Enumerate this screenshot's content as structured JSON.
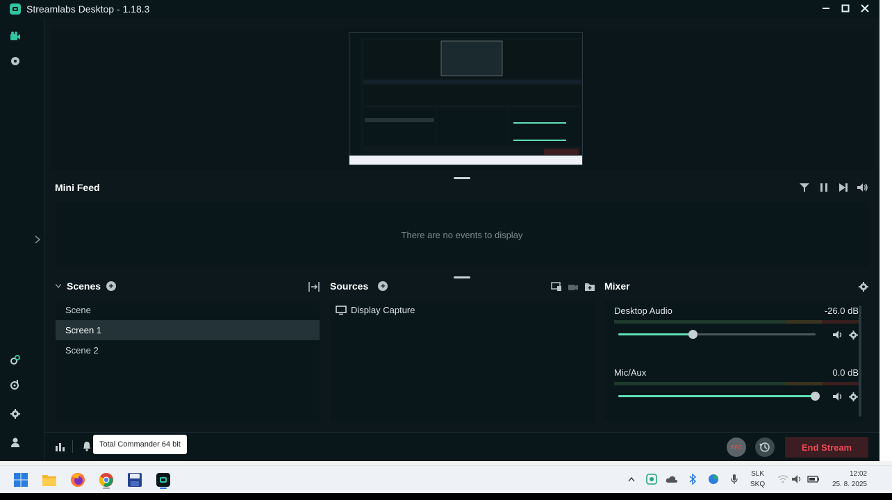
{
  "window": {
    "title": "Streamlabs Desktop - 1.18.3",
    "controls": [
      "minimize",
      "maximize",
      "close"
    ]
  },
  "sidebar": {
    "top_icons": [
      "studio-icon",
      "themes-icon"
    ],
    "bottom_icons": [
      "link-icon",
      "music-icon",
      "settings-icon",
      "profile-icon"
    ]
  },
  "mini_feed": {
    "title": "Mini Feed",
    "empty_text": "There are no events to display",
    "controls": [
      "filter-icon",
      "pause-icon",
      "skip-icon",
      "volume-icon"
    ]
  },
  "scenes": {
    "title": "Scenes",
    "items": [
      {
        "label": "Scene",
        "active": false
      },
      {
        "label": "Screen 1",
        "active": true
      },
      {
        "label": "Scene 2",
        "active": false
      }
    ]
  },
  "sources": {
    "title": "Sources",
    "items": [
      {
        "label": "Display Capture",
        "icon": "monitor-icon"
      }
    ]
  },
  "mixer": {
    "title": "Mixer",
    "channels": [
      {
        "name": "Desktop Audio",
        "db": "-26.0 dB",
        "volume_fraction": 0.38
      },
      {
        "name": "Mic/Aux",
        "db": "0.0 dB",
        "volume_fraction": 1.0
      }
    ]
  },
  "footer": {
    "rec_label": "REC",
    "end_stream_label": "End Stream",
    "tooltip": "Total Commander 64 bit"
  },
  "taskbar": {
    "apps": [
      "start",
      "file-explorer",
      "firefox",
      "chrome",
      "total-commander",
      "streamlabs"
    ],
    "language": {
      "line1": "SLK",
      "line2": "SKQ"
    },
    "clock": {
      "time": "12:02",
      "date": "25. 8. 2025"
    }
  },
  "colors": {
    "accent": "#31c3a2",
    "slider_fill": "#5fe0b5",
    "end_stream_text": "#ef4a55",
    "background": "#0c181c"
  }
}
